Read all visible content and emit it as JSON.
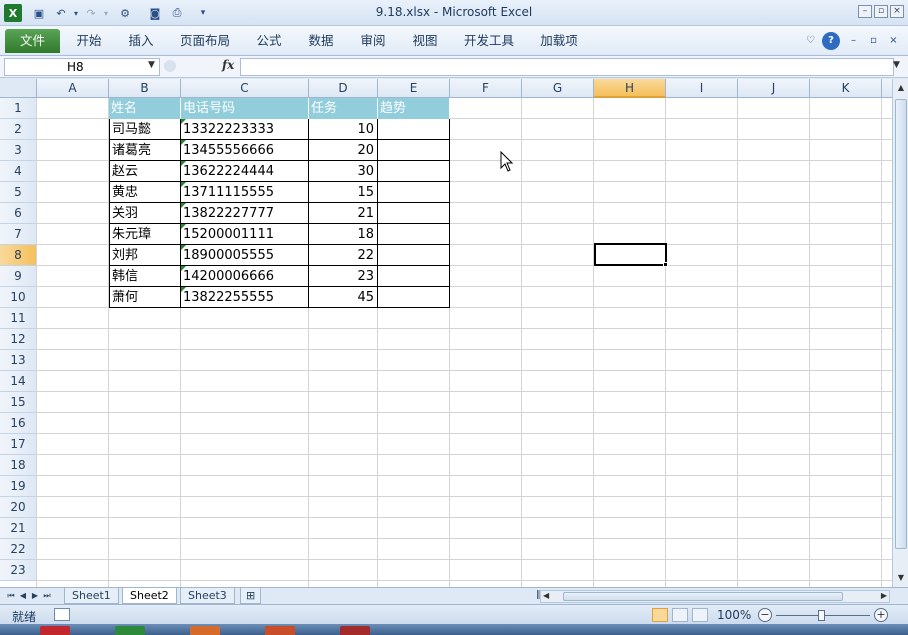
{
  "app": {
    "title": "9.18.xlsx  -  Microsoft Excel",
    "icon": "excel-icon"
  },
  "ribbon": {
    "tabs": [
      "文件",
      "开始",
      "插入",
      "页面布局",
      "公式",
      "数据",
      "审阅",
      "视图",
      "开发工具",
      "加载项"
    ]
  },
  "formula_bar": {
    "name_box": "H8",
    "fx": "fx",
    "formula": ""
  },
  "grid": {
    "columns": [
      "A",
      "B",
      "C",
      "D",
      "E",
      "F",
      "G",
      "H",
      "I",
      "J",
      "K"
    ],
    "rows": [
      "1",
      "2",
      "3",
      "4",
      "5",
      "6",
      "7",
      "8",
      "9",
      "10",
      "11",
      "12",
      "13",
      "14",
      "15",
      "16",
      "17",
      "18",
      "19",
      "20",
      "21",
      "22",
      "23"
    ],
    "selected_cell": "H8",
    "table_header": [
      "姓名",
      "电话号码",
      "任务",
      "趋势"
    ],
    "table_rows": [
      [
        "司马懿",
        "13322223333",
        "10",
        ""
      ],
      [
        "诸葛亮",
        "13455556666",
        "20",
        ""
      ],
      [
        "赵云",
        "13622224444",
        "30",
        ""
      ],
      [
        "黄忠",
        "13711115555",
        "15",
        ""
      ],
      [
        "关羽",
        "13822227777",
        "21",
        ""
      ],
      [
        "朱元璋",
        "15200001111",
        "18",
        ""
      ],
      [
        "刘邦",
        "18900005555",
        "22",
        ""
      ],
      [
        "韩信",
        "14200006666",
        "23",
        ""
      ],
      [
        "萧何",
        "13822255555",
        "45",
        ""
      ]
    ]
  },
  "sheets": {
    "tabs": [
      "Sheet1",
      "Sheet2",
      "Sheet3"
    ],
    "active": "Sheet2"
  },
  "status": {
    "ready": "就绪",
    "zoom": "100%"
  },
  "colors": {
    "header_fill": "#92cddc",
    "file_tab": "#2f7a2b",
    "selection_header": "#f4c05b"
  }
}
